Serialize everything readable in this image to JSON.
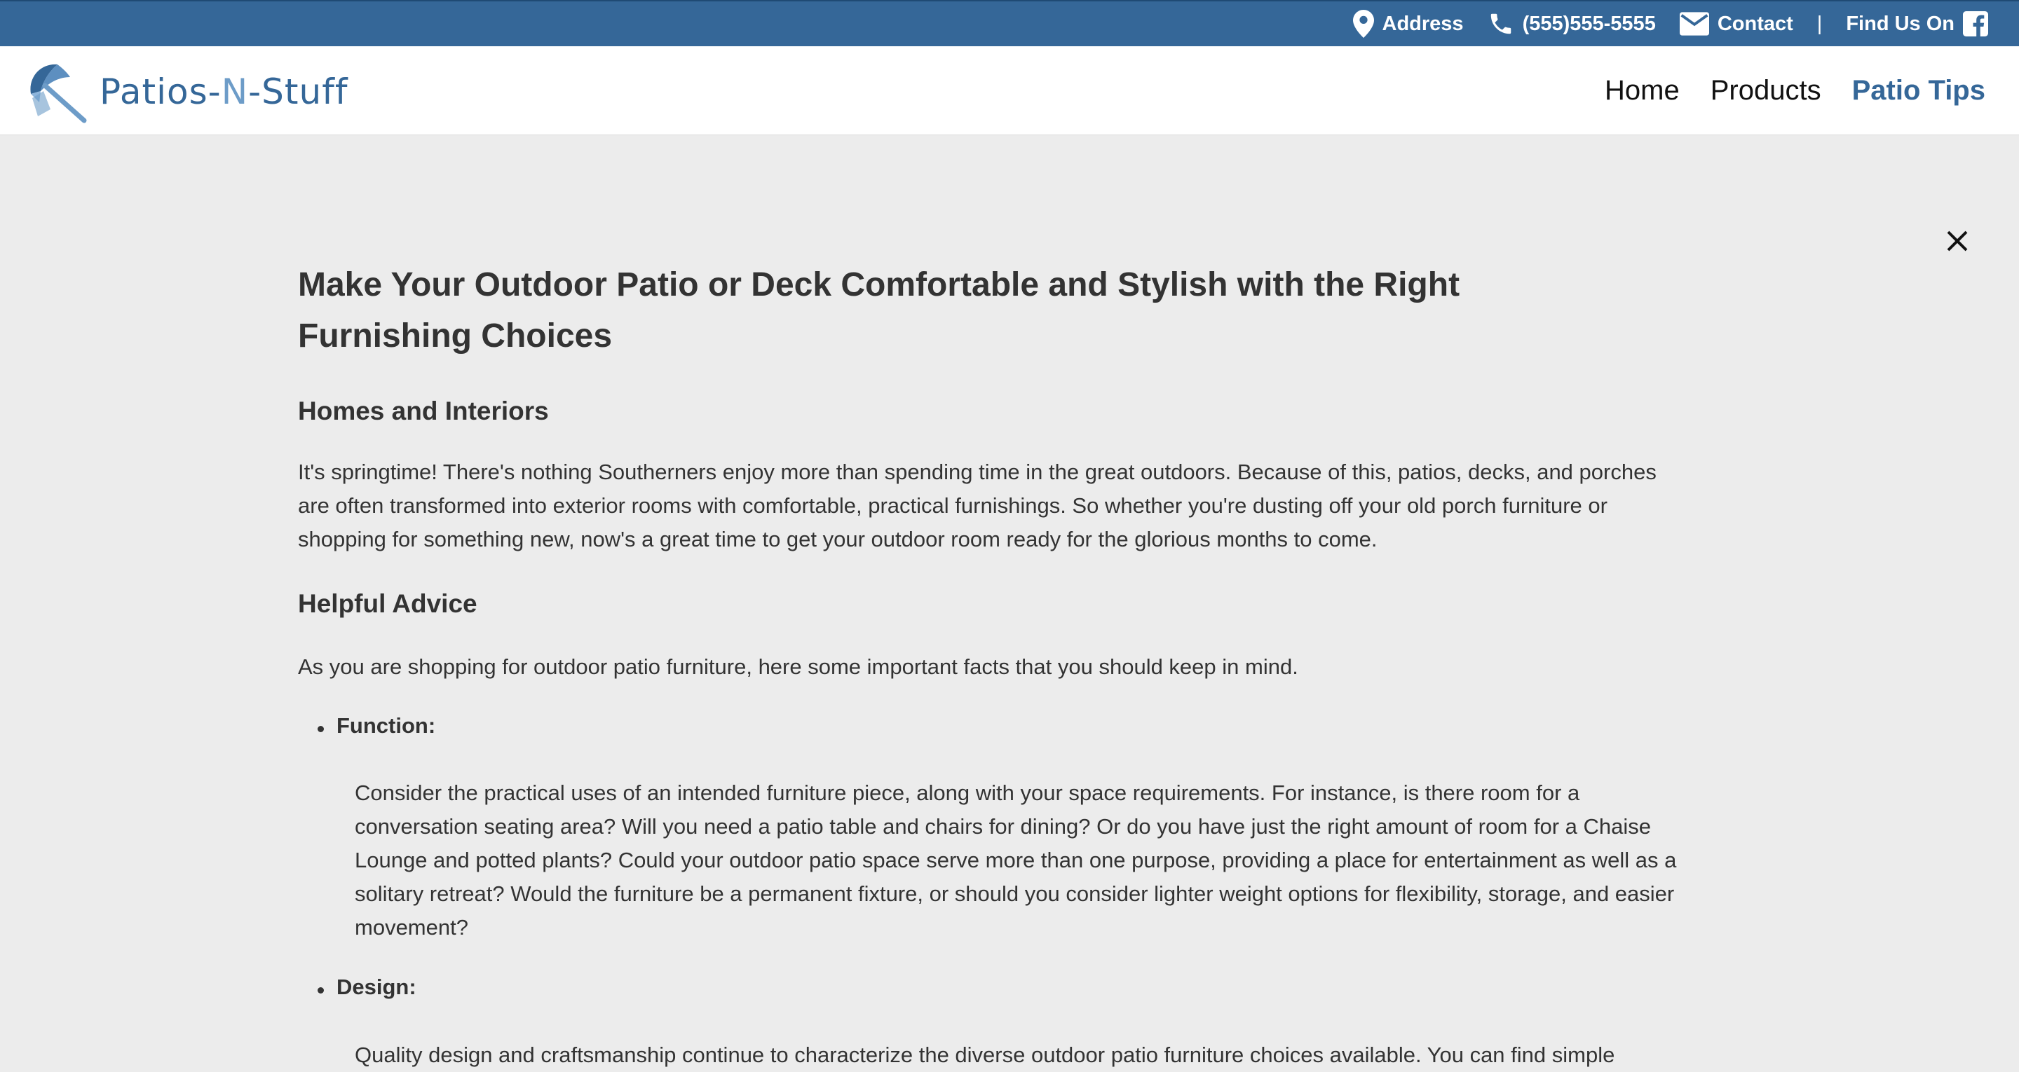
{
  "topbar": {
    "address": "Address",
    "phone": "(555)555-5555",
    "contact": "Contact",
    "separator": "|",
    "find_us": "Find Us On"
  },
  "header": {
    "logo_text_a": "Patios-",
    "logo_text_n": "N",
    "logo_text_b": "-Stuff",
    "nav": {
      "home": "Home",
      "products": "Products",
      "patio_tips": "Patio Tips"
    }
  },
  "article": {
    "title": "Make Your Outdoor Patio or Deck Comfortable and Stylish with the Right Furnishing Choices",
    "section1_title": "Homes and Interiors",
    "section1_body": "It's springtime! There's nothing Southerners enjoy more than spending time in the great outdoors. Because of this, patios, decks, and porches are often transformed into exterior rooms with comfortable, practical furnishings. So whether you're dusting off your old porch furniture or shopping for something new, now's a great time to get your outdoor room ready for the glorious months to come.",
    "section2_title": "Helpful Advice",
    "section2_body": "As you are shopping for outdoor patio furniture, here some important facts that you should keep in mind.",
    "bullets": [
      {
        "label": "Function:",
        "body": "Consider the practical uses of an intended furniture piece, along with your space requirements. For instance, is there room for a conversation seating area? Will you need a patio table and chairs for dining? Or do you have just the right amount of room for a Chaise Lounge and potted plants? Could your outdoor patio space serve more than one purpose, providing a place for entertainment as well as a solitary retreat? Would the furniture be a permanent fixture, or should you consider lighter weight options for flexibility, storage, and easier movement?"
      },
      {
        "label": "Design:",
        "body": "Quality design and craftsmanship continue to characterize the diverse outdoor patio furniture choices available. You can find simple"
      }
    ]
  },
  "colors": {
    "brand_blue": "#356798",
    "light_blue": "#6d9cc8",
    "page_bg": "#ececec"
  }
}
